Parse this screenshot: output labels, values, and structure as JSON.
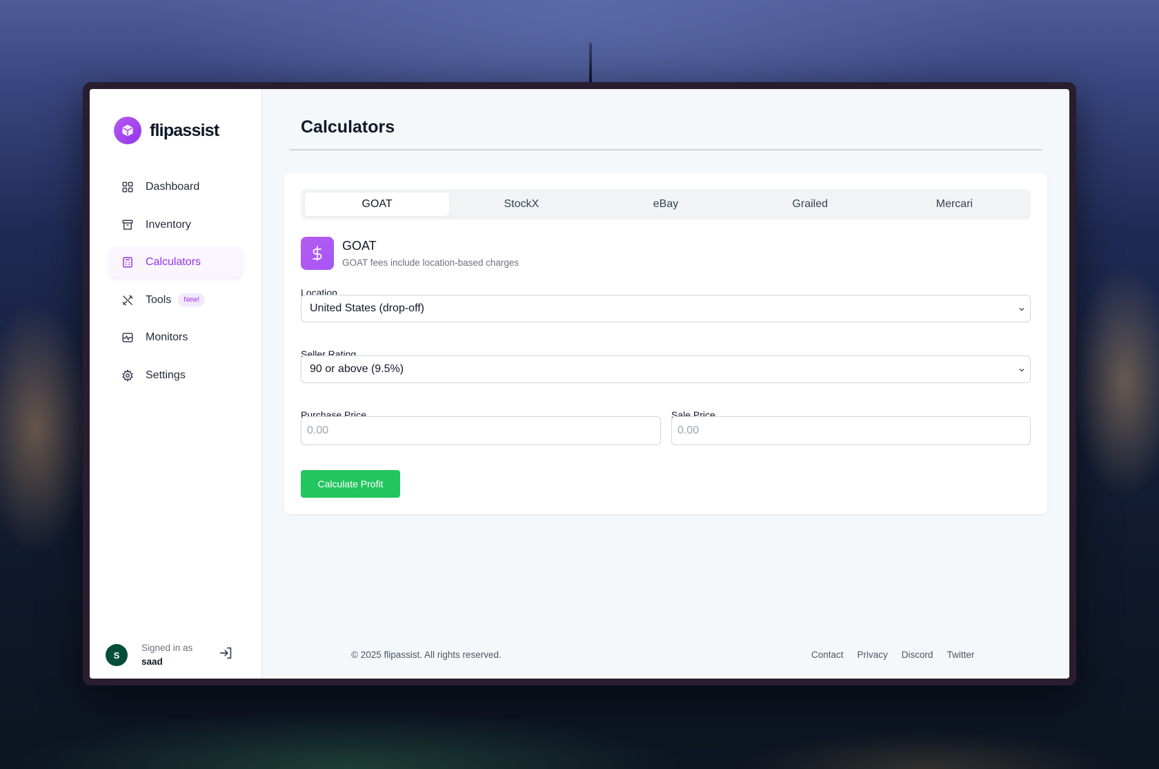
{
  "brand": {
    "name": "flipassist"
  },
  "sidebar": {
    "items": [
      {
        "label": "Dashboard",
        "icon": "dashboard-grid-icon"
      },
      {
        "label": "Inventory",
        "icon": "archive-box-icon"
      },
      {
        "label": "Calculators",
        "icon": "calculator-icon",
        "active": true
      },
      {
        "label": "Tools",
        "icon": "tools-icon",
        "badge": "New!"
      },
      {
        "label": "Monitors",
        "icon": "monitor-pulse-icon"
      },
      {
        "label": "Settings",
        "icon": "gear-icon"
      }
    ],
    "user": {
      "avatar_initial": "S",
      "caption": "Signed in as",
      "name": "saad"
    }
  },
  "main": {
    "title": "Calculators",
    "tabs": [
      "GOAT",
      "StockX",
      "eBay",
      "Grailed",
      "Mercari"
    ],
    "active_tab": "GOAT",
    "calculator": {
      "name": "GOAT",
      "description": "GOAT fees include location-based charges",
      "icon": "dollar-icon",
      "location_label": "Location",
      "location_value": "United States (drop-off)",
      "seller_rating_label": "Seller Rating",
      "seller_rating_value": "90 or above (9.5%)",
      "purchase_price_label": "Purchase Price",
      "purchase_price_placeholder": "0.00",
      "sale_price_label": "Sale Price",
      "sale_price_placeholder": "0.00",
      "button_label": "Calculate Profit"
    }
  },
  "footer": {
    "copyright": "© 2025 flipassist. All rights reserved.",
    "links": [
      "Contact",
      "Privacy",
      "Discord",
      "Twitter"
    ]
  },
  "colors": {
    "accent": "#9333ea",
    "accent_bg": "#faf5ff",
    "button_green": "#22c55e",
    "avatar_green": "#064e3b"
  }
}
